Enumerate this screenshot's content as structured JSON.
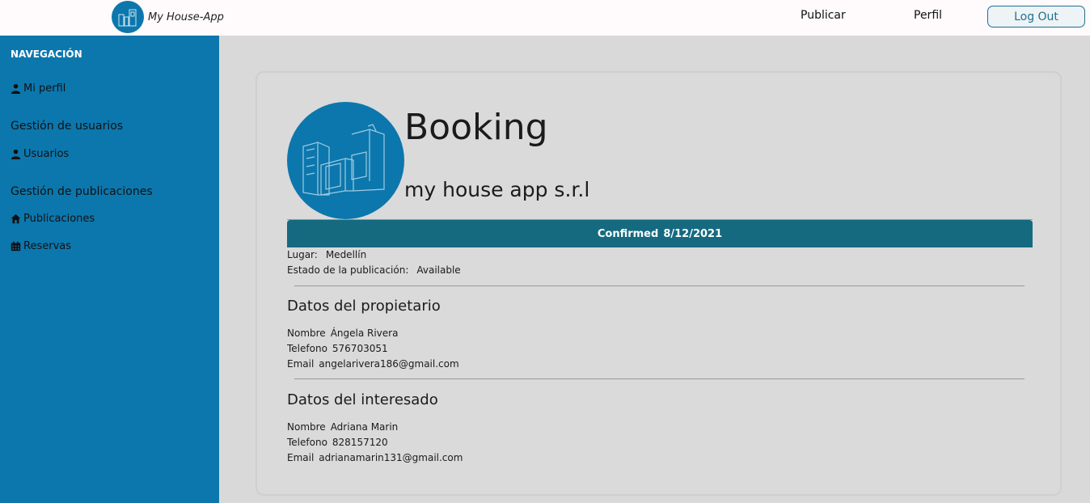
{
  "navbar": {
    "brand_name": "My House-App",
    "links": [
      "Publicar",
      "Perfil"
    ],
    "logout_label": "Log Out"
  },
  "sidebar": {
    "heading": "NAVEGACIÓN",
    "items": [
      {
        "label": "Mi perfil",
        "icon": "user-icon"
      },
      {
        "label": "Usuarios",
        "icon": "user-icon"
      },
      {
        "label": "Publicaciones",
        "icon": "house-icon"
      },
      {
        "label": "Reservas",
        "icon": "calendar-icon"
      }
    ],
    "sections": [
      "Gestión de usuarios",
      "Gestión de publicaciones"
    ]
  },
  "booking": {
    "title": "Booking",
    "company": "my house app s.r.l",
    "status": "Confirmed",
    "date": "8/12/2021",
    "lugar_label": "Lugar:",
    "lugar_value": "Medellín",
    "estado_label": "Estado de la publicación:",
    "estado_value": "Available"
  },
  "owner": {
    "section_title": "Datos del propietario",
    "nombre_label": "Nombre",
    "nombre": "Ángela Rivera",
    "telefono_label": "Telefono",
    "telefono": "576703051",
    "email_label": "Email",
    "email": "angelarivera186@gmail.com"
  },
  "interested": {
    "section_title": "Datos del interesado",
    "nombre_label": "Nombre",
    "nombre": "Adriana Marin",
    "telefono_label": "Telefono",
    "telefono": "828157120",
    "email_label": "Email",
    "email": "adrianamarin131@gmail.com"
  },
  "colors": {
    "brand_blue": "#0c77ad",
    "status_bar": "#156a80",
    "background": "#d9d9d9"
  }
}
